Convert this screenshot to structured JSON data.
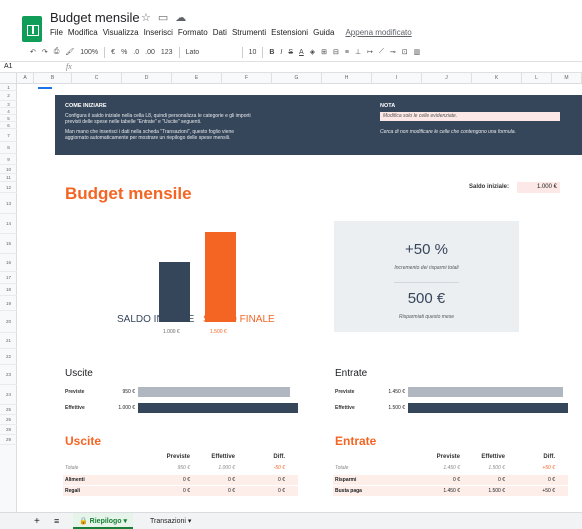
{
  "app": {
    "doc_title": "Budget mensile",
    "last_edit": "Appena modificato"
  },
  "menu": [
    "File",
    "Modifica",
    "Visualizza",
    "Inserisci",
    "Formato",
    "Dati",
    "Strumenti",
    "Estensioni",
    "Guida"
  ],
  "toolbar": {
    "zoom": "100%",
    "euro": "€",
    "percent": "%",
    "dec_less": ".0",
    "dec_more": ".00",
    "format": "123",
    "font": "Lato",
    "font_size": "10",
    "bold": "B",
    "italic": "I",
    "strike": "S",
    "textcolor": "A"
  },
  "formula": {
    "namebox": "A1",
    "fx": "fx"
  },
  "columns": [
    "A",
    "B",
    "C",
    "D",
    "E",
    "F",
    "G",
    "H",
    "I",
    "J",
    "K",
    "L",
    "M"
  ],
  "rows": [
    "1",
    "2",
    "3",
    "4",
    "5",
    "6",
    "7",
    "8",
    "9",
    "10",
    "11",
    "12",
    "13",
    "14",
    "15",
    "16",
    "17",
    "18",
    "19",
    "20",
    "21",
    "22",
    "23",
    "24",
    "25",
    "26",
    "28",
    "29"
  ],
  "banner": {
    "heading": "COME INIZIARE",
    "p1": "Configura il saldo iniziale nella cella L8, quindi personalizza le categorie e gli importi",
    "p2": "previsti delle spese nelle tabelle \"Entrate\" e \"Uscite\" seguenti.",
    "p3": "Man mano che inserisci i dati nella scheda \"Transazioni\", questo foglio viene",
    "p4": "aggiornato automaticamente per mostrare un riepilogo delle spese mensili.",
    "nota_heading": "NOTA",
    "nota_highlight": "Modifica solo le celle evidenziate.",
    "nota_text": "Cerca di non modificare le celle che contengono una formula."
  },
  "main": {
    "title": "Budget mensile",
    "saldo_label": "Saldo iniziale:",
    "saldo_value": "1.000 €"
  },
  "chart_data": {
    "type": "bar",
    "categories": [
      "SALDO INIZIALE",
      "SALDO FINALE"
    ],
    "values": [
      1000,
      1500
    ],
    "value_labels": [
      "1.000 €",
      "1.500 €"
    ],
    "colors": [
      "#36465a",
      "#f46524"
    ]
  },
  "kpi": {
    "pct": "+50 %",
    "pct_label": "Incremento dei risparmi totali",
    "amount": "500 €",
    "amount_label": "Risparmiati questo mese"
  },
  "uscite_summary": {
    "title": "Uscite",
    "rows": [
      {
        "label": "Previste",
        "value": "950 €",
        "frac": 0.95,
        "color": "#b0b7c0"
      },
      {
        "label": "Effettive",
        "value": "1.000 €",
        "frac": 1.0,
        "color": "#36465a"
      }
    ]
  },
  "entrate_summary": {
    "title": "Entrate",
    "rows": [
      {
        "label": "Previste",
        "value": "1.450 €",
        "frac": 0.97,
        "color": "#b0b7c0"
      },
      {
        "label": "Effettive",
        "value": "1.500 €",
        "frac": 1.0,
        "color": "#36465a"
      }
    ]
  },
  "uscite_table": {
    "title": "Uscite",
    "headers": [
      "Previste",
      "Effettive",
      "Diff."
    ],
    "total": {
      "label": "Totale",
      "values": [
        "950 €",
        "1.000 €",
        "-50 €"
      ]
    },
    "rows": [
      {
        "label": "Alimenti",
        "values": [
          "0 €",
          "0 €",
          "0 €"
        ]
      },
      {
        "label": "Regali",
        "values": [
          "0 €",
          "0 €",
          "0 €"
        ]
      }
    ]
  },
  "entrate_table": {
    "title": "Entrate",
    "headers": [
      "Previste",
      "Effettive",
      "Diff."
    ],
    "total": {
      "label": "Totale",
      "values": [
        "1.450 €",
        "1.500 €",
        "+50 €"
      ]
    },
    "rows": [
      {
        "label": "Risparmi",
        "values": [
          "0 €",
          "0 €",
          "0 €"
        ]
      },
      {
        "label": "Busta paga",
        "values": [
          "1.450 €",
          "1.500 €",
          "+50 €"
        ]
      }
    ]
  },
  "tabs": {
    "active": "Riepilogo",
    "other": "Transazioni"
  }
}
